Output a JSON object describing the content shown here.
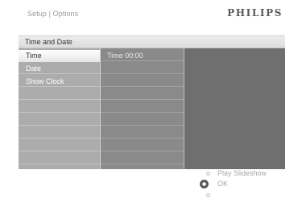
{
  "header": {
    "breadcrumb": "Setup | Options",
    "brand": "PHILIPS"
  },
  "title_bar": {
    "label": "Time and Date"
  },
  "menu": {
    "items": [
      {
        "label": "Time",
        "selected": true
      },
      {
        "label": "Date",
        "selected": false
      },
      {
        "label": "Show Clock",
        "selected": false
      }
    ]
  },
  "value_panel": {
    "label": "Time  00:00"
  },
  "footer": {
    "hints": [
      {
        "label": "Play Slideshow",
        "icon": "up-dot-icon"
      },
      {
        "label": "OK",
        "icon": "ok-button-icon"
      },
      {
        "label": "",
        "icon": "down-dot-icon"
      }
    ]
  }
}
